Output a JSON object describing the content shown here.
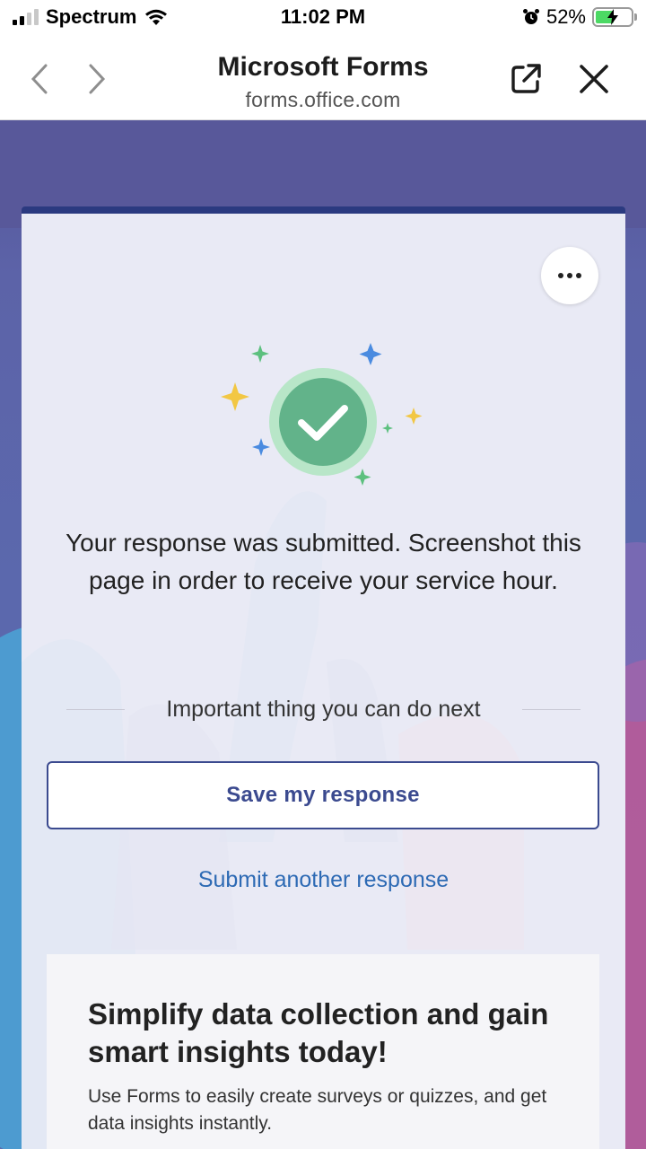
{
  "status_bar": {
    "carrier": "Spectrum",
    "time": "11:02 PM",
    "battery_percent": "52%",
    "battery_level": 0.52,
    "icons": [
      "signal-icon",
      "wifi-icon",
      "alarm-icon",
      "battery-charging-icon"
    ]
  },
  "browser": {
    "title": "Microsoft Forms",
    "url": "forms.office.com",
    "icons": [
      "chevron-left-icon",
      "chevron-right-icon",
      "share-external-icon",
      "close-icon"
    ]
  },
  "card": {
    "accent_color": "#2b3a80",
    "success_icon": "checkmark-circle-icon",
    "message": "Your response was submitted. Screenshot this page in order to receive your service hour.",
    "next_label": "Important thing you can do next",
    "save_button": "Save my response",
    "submit_another": "Submit another response"
  },
  "promo": {
    "title": "Simplify data collection and gain smart insights today!",
    "description": "Use Forms to easily create surveys or quizzes, and get data insights instantly."
  }
}
